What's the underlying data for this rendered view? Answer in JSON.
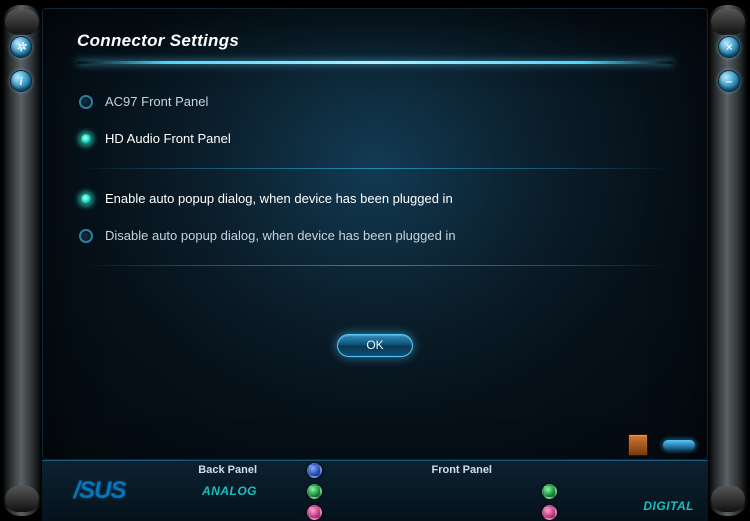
{
  "title": "Connector Settings",
  "front_panel_type": {
    "options": [
      {
        "label": "AC97 Front Panel",
        "selected": false
      },
      {
        "label": "HD Audio Front Panel",
        "selected": true
      }
    ]
  },
  "popup_setting": {
    "options": [
      {
        "label": "Enable auto popup dialog, when device has been plugged in",
        "selected": true
      },
      {
        "label": "Disable auto popup dialog, when device has been plugged in",
        "selected": false
      }
    ]
  },
  "ok_label": "OK",
  "logo_text": "/SUS",
  "bottom": {
    "back_panel_label": "Back Panel",
    "front_panel_label": "Front Panel",
    "analog_label": "ANALOG",
    "digital_label": "DIGITAL"
  },
  "side_buttons": {
    "settings_tooltip": "Settings",
    "info_tooltip": "Information",
    "close_tooltip": "Close",
    "minimize_tooltip": "Minimize"
  }
}
